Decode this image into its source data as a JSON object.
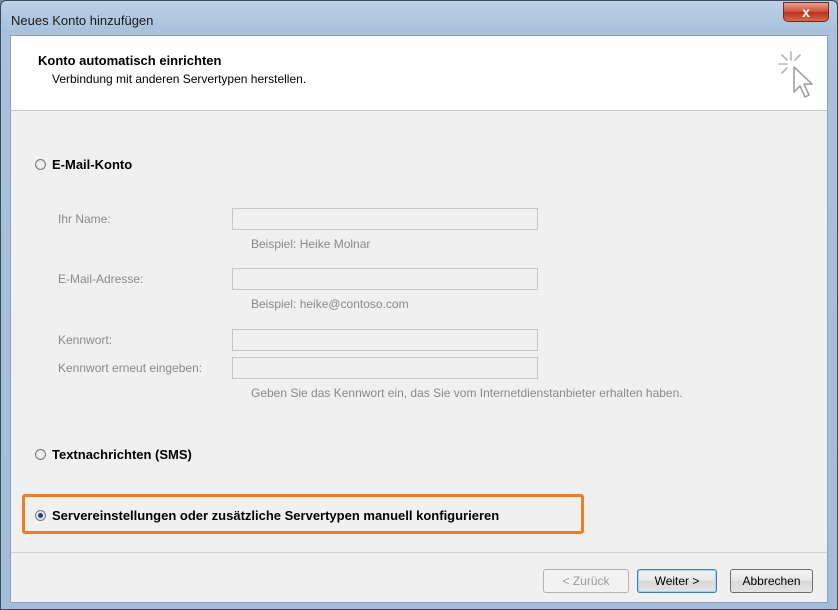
{
  "window": {
    "title": "Neues Konto hinzufügen",
    "close_glyph": "x"
  },
  "header": {
    "title": "Konto automatisch einrichten",
    "subtitle": "Verbindung mit anderen Servertypen herstellen.",
    "icon": "cursor-sparkle-icon"
  },
  "options": {
    "email": {
      "label": "E-Mail-Konto",
      "selected": false
    },
    "sms": {
      "label": "Textnachrichten (SMS)",
      "selected": false
    },
    "manual": {
      "label": "Servereinstellungen oder zusätzliche Servertypen manuell konfigurieren",
      "selected": true
    }
  },
  "fields": {
    "name": {
      "label": "Ihr Name:",
      "value": "",
      "hint": "Beispiel: Heike Molnar"
    },
    "email": {
      "label": "E-Mail-Adresse:",
      "value": "",
      "hint": "Beispiel: heike@contoso.com"
    },
    "password": {
      "label": "Kennwort:",
      "value": ""
    },
    "password_repeat": {
      "label": "Kennwort erneut eingeben:",
      "value": "",
      "hint": "Geben Sie das Kennwort ein, das Sie vom Internetdienstanbieter erhalten haben."
    }
  },
  "buttons": {
    "back": "< Zurück",
    "next": "Weiter >",
    "cancel": "Abbrechen"
  },
  "colors": {
    "highlight": "#ef7d22"
  }
}
